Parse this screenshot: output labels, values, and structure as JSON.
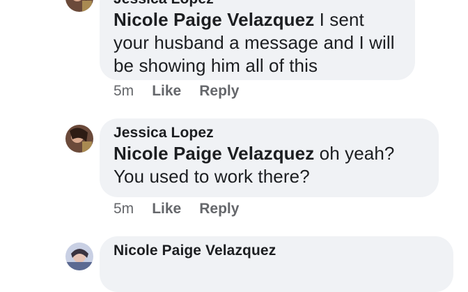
{
  "comments": [
    {
      "author": "Jessica Lopez",
      "mention": "Nicole Paige Velazquez",
      "text": " I sent your husband a message and I will be showing him all of this",
      "time": "5m",
      "like_label": "Like",
      "reply_label": "Reply"
    },
    {
      "author": "Jessica Lopez",
      "mention": "Nicole Paige Velazquez",
      "text": " oh yeah? You used to work there?",
      "time": "5m",
      "like_label": "Like",
      "reply_label": "Reply"
    },
    {
      "author": "Nicole Paige Velazquez"
    }
  ],
  "colors": {
    "bubble": "#f0f2f5",
    "text": "#1c1e21",
    "meta": "#65676b"
  }
}
